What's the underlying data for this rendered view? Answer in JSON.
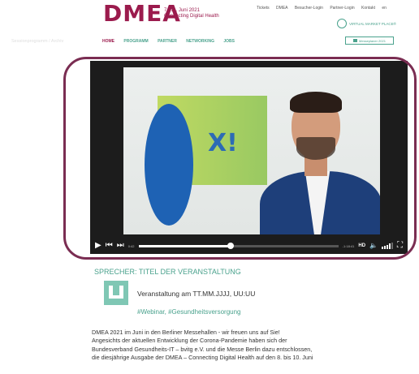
{
  "header": {
    "logo": "DMEA",
    "logo_date": "7.–11. Juni 2021",
    "logo_tagline": "Connecting Digital Health",
    "top_links": [
      "Tickets",
      "DMEA",
      "Besucher-Login",
      "Partner-Login",
      "Kontakt",
      "en"
    ],
    "vmp_label": "VIRTUAL MARKET PLACE®",
    "breadcrumb": "Sessionprogramm / Archiv",
    "nav": [
      "HOME",
      "PROGRAMM",
      "PARTNER",
      "NETWORKING",
      "JOBS"
    ],
    "nav_button": "Messeplaner 2021"
  },
  "player": {
    "time": "0:42",
    "remaining": "-1:18:41",
    "quality": "HD",
    "progress": 0.46,
    "volume_level": 0.7
  },
  "event": {
    "section_title": "SPRECHER: TITEL DER VERANSTALTUNG",
    "date_line": "Veranstaltung am TT.MM.JJJJ, UU:UU",
    "tags": "#Webinar, #Gesundheitsversorgung",
    "description": [
      "DMEA 2021 im Juni in den Berliner Messehallen - wir freuen uns auf Sie!",
      "Angesichts der aktuellen Entwicklung der Corona-Pandemie haben sich der",
      "Bundesverband Gesundheits-IT – bvitg e.V. und die Messe Berlin dazu entschlossen,",
      "die diesjährige Ausgabe der DMEA – Connecting Digital Health auf den 8. bis 10. Juni"
    ]
  },
  "colors": {
    "brand": "#9b1b4d",
    "accent": "#4aa28d",
    "highlight": "#7a2d52"
  }
}
